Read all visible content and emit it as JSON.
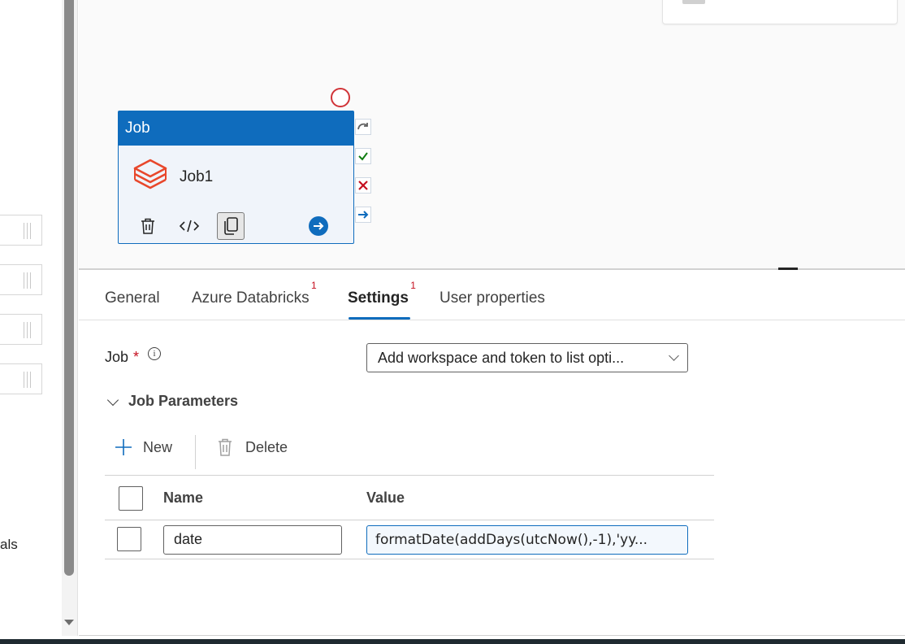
{
  "left_panel": {
    "cut_text": "als"
  },
  "activity": {
    "type_label": "Job",
    "name": "Job1",
    "buttons": [
      "delete-icon",
      "code-icon",
      "copy-icon",
      "go-to-icon"
    ],
    "statuses": [
      "skip-icon",
      "success-icon",
      "failure-icon",
      "completion-icon"
    ]
  },
  "tabs": [
    {
      "label": "General",
      "badge": ""
    },
    {
      "label": "Azure Databricks",
      "badge": "1"
    },
    {
      "label": "Settings",
      "badge": "1"
    },
    {
      "label": "User properties",
      "badge": ""
    }
  ],
  "settings": {
    "job_label": "Job",
    "required_mark": "*",
    "info_glyph": "i",
    "job_dropdown_value": "Add workspace and token to list opti...",
    "section_title": "Job Parameters",
    "toolbar": {
      "new_label": "New",
      "delete_label": "Delete"
    },
    "grid": {
      "columns": [
        "Name",
        "Value"
      ],
      "rows": [
        {
          "name": "date",
          "value": "formatDate(addDays(utcNow(),-1),'yy..."
        }
      ]
    }
  },
  "colors": {
    "accent": "#0f6cbd",
    "required": "#c50f1f",
    "databricks": "#e8472b"
  }
}
